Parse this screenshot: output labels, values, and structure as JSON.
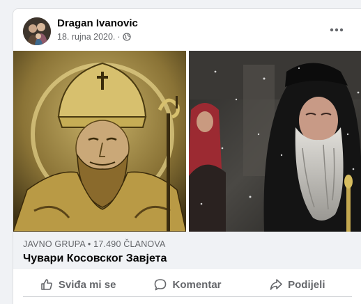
{
  "post": {
    "author": "Dragan Ivanovic",
    "date": "18. rujna 2020.",
    "separator": "·",
    "privacy_icon": "globe-icon",
    "more_icon": "more-horizontal-icon"
  },
  "link_preview": {
    "meta": "JAVNO GRUPA • 17.490 ČLANOVA",
    "title": "Чувари Косовског Завјета"
  },
  "actions": {
    "like": "Sviđa mi se",
    "comment": "Komentar",
    "share": "Podijeli"
  },
  "colors": {
    "secondary_text": "#65676b",
    "preview_bg": "#f0f2f5",
    "icon_gray": "#65676b"
  }
}
